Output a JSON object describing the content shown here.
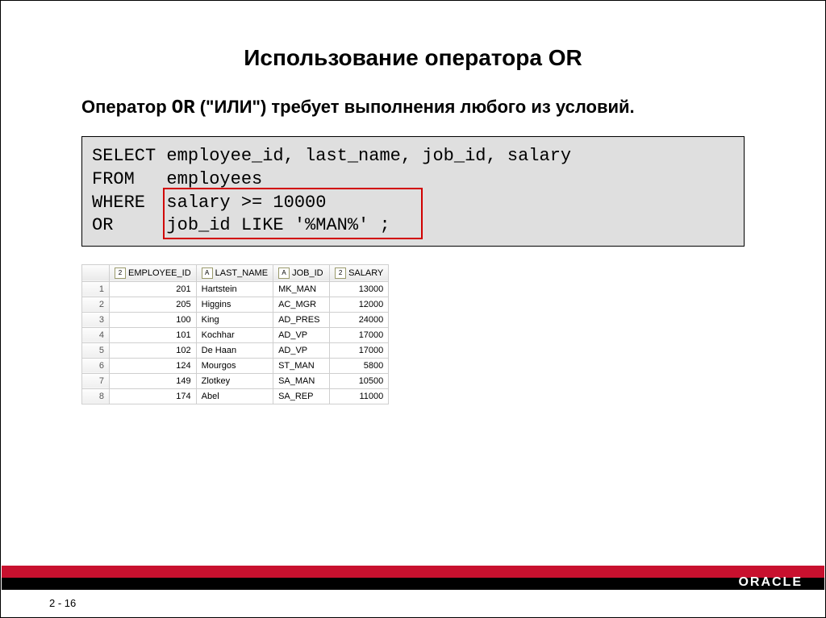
{
  "title": "Использование оператора OR",
  "subtitle_prefix": "Оператор ",
  "subtitle_code": "OR",
  "subtitle_rest": " (\"ИЛИ\") требует выполнения любого из условий.",
  "code": {
    "l1": "SELECT employee_id, last_name, job_id, salary",
    "l2": "FROM   employees",
    "l3": "WHERE  salary >= 10000",
    "l4": "OR     job_id LIKE '%MAN%' ;"
  },
  "columns": {
    "c1": "EMPLOYEE_ID",
    "c2": "LAST_NAME",
    "c3": "JOB_ID",
    "c4": "SALARY"
  },
  "rows": [
    {
      "n": "1",
      "emp": "201",
      "last": "Hartstein",
      "job": "MK_MAN",
      "sal": "13000"
    },
    {
      "n": "2",
      "emp": "205",
      "last": "Higgins",
      "job": "AC_MGR",
      "sal": "12000"
    },
    {
      "n": "3",
      "emp": "100",
      "last": "King",
      "job": "AD_PRES",
      "sal": "24000"
    },
    {
      "n": "4",
      "emp": "101",
      "last": "Kochhar",
      "job": "AD_VP",
      "sal": "17000"
    },
    {
      "n": "5",
      "emp": "102",
      "last": "De Haan",
      "job": "AD_VP",
      "sal": "17000"
    },
    {
      "n": "6",
      "emp": "124",
      "last": "Mourgos",
      "job": "ST_MAN",
      "sal": "5800"
    },
    {
      "n": "7",
      "emp": "149",
      "last": "Zlotkey",
      "job": "SA_MAN",
      "sal": "10500"
    },
    {
      "n": "8",
      "emp": "174",
      "last": "Abel",
      "job": "SA_REP",
      "sal": "11000"
    }
  ],
  "page_number": "2 - 16",
  "logo_text": "ORACLE"
}
